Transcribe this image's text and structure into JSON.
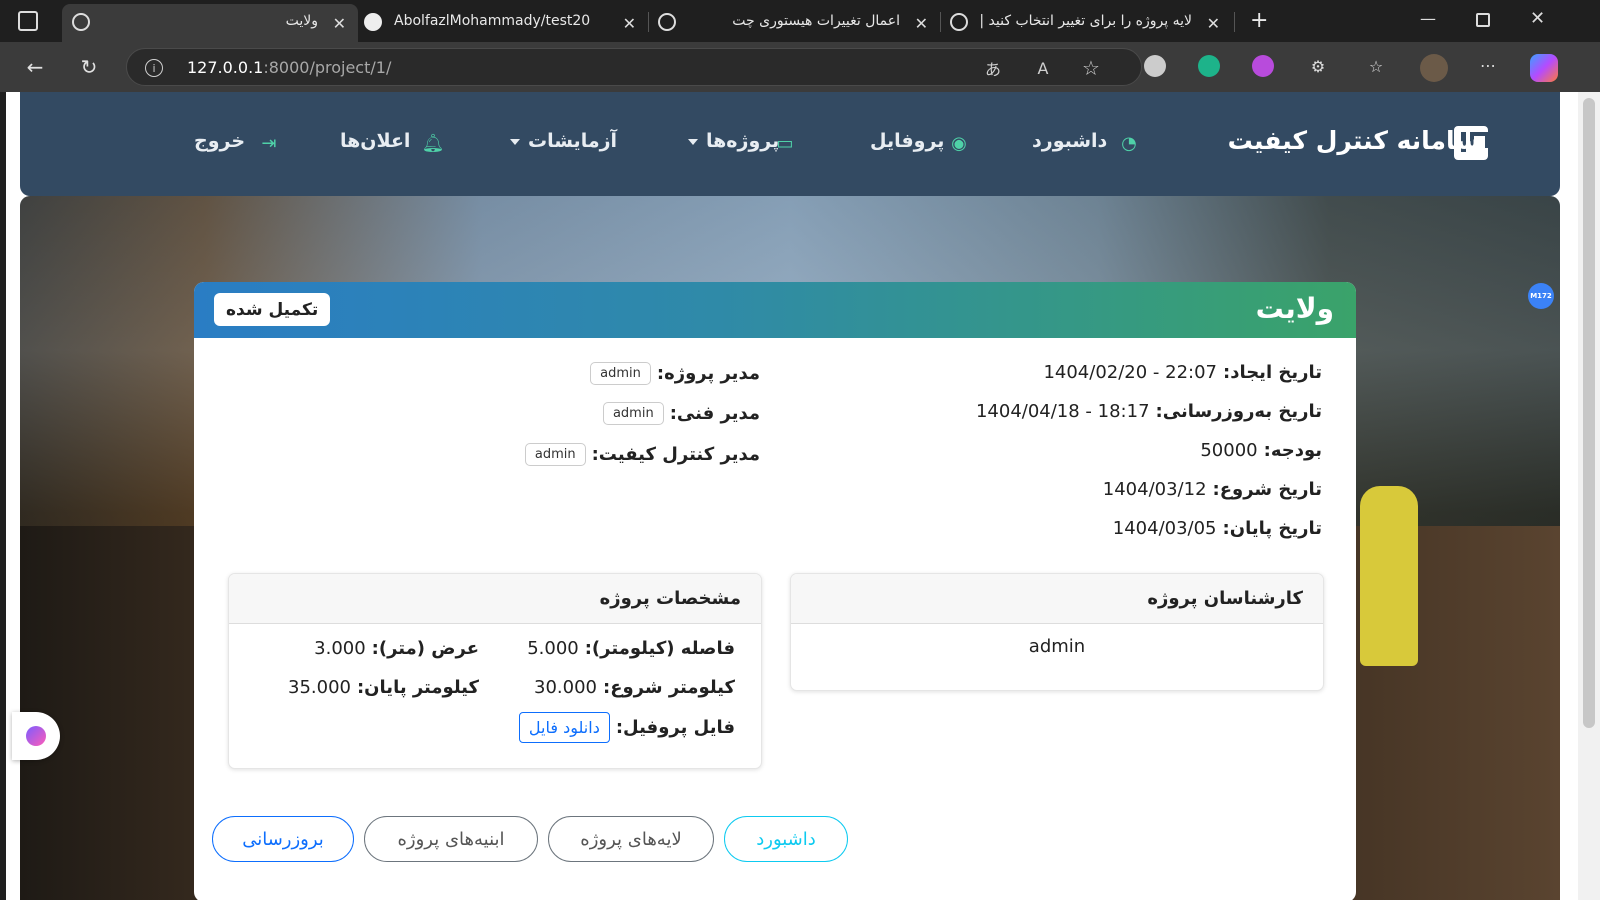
{
  "browser": {
    "tabs": [
      {
        "title": "ولایت",
        "icon": "globe-icon"
      },
      {
        "title": "AbolfazlMohammady/test20",
        "icon": "github-icon"
      },
      {
        "title": "اعمال تغییرات هیستوری چت",
        "icon": "chatgpt-icon"
      },
      {
        "title": "لایه پروژه را برای تغییر انتخاب کنید |",
        "icon": "globe-icon"
      }
    ],
    "url_host": "127.0.0.1",
    "url_rest": ":8000/project/1/"
  },
  "navbar": {
    "brand": "سامانه کنترل کیفیت",
    "items": [
      {
        "label": "داشبورد",
        "icon": "gauge-icon"
      },
      {
        "label": "پروفایل",
        "icon": "user-circle-icon"
      },
      {
        "label": "پروژه‌ها",
        "icon": "briefcase-icon"
      },
      {
        "label": "آزمایشات",
        "icon": ""
      },
      {
        "label": "اعلان‌ها",
        "icon": "bell-icon"
      },
      {
        "label": "خروج",
        "icon": "logout-icon"
      }
    ]
  },
  "project": {
    "title": "ولایت",
    "status": "تکمیل شده",
    "created_label": "تاریخ ایجاد:",
    "created_value": "1404/02/20 - 22:07",
    "updated_label": "تاریخ به‌روزرسانی:",
    "updated_value": "1404/04/18 - 18:17",
    "budget_label": "بودجه:",
    "budget_value": "50000",
    "start_label": "تاریخ شروع:",
    "start_value": "1404/03/12",
    "end_label": "تاریخ پایان:",
    "end_value": "1404/03/05",
    "pm_label": "مدیر پروژه:",
    "pm_value": "admin",
    "tech_label": "مدیر فنی:",
    "tech_value": "admin",
    "qc_label": "مدیر کنترل کیفیت:",
    "qc_value": "admin"
  },
  "experts": {
    "title": "کارشناسان پروژه",
    "items": [
      "admin"
    ]
  },
  "specs": {
    "title": "مشخصات پروژه",
    "distance_label": "فاصله (کیلومتر):",
    "distance_value": "5.000",
    "width_label": "عرض (متر):",
    "width_value": "3.000",
    "start_km_label": "کیلومتر شروع:",
    "start_km_value": "30.000",
    "end_km_label": "کیلومتر پایان:",
    "end_km_value": "35.000",
    "profile_label": "فایل پروفیل:",
    "download_label": "دانلود فایل"
  },
  "actions": {
    "dashboard": "داشبورد",
    "layers": "لایه‌های پروژه",
    "structures": "ابنیه‌های پروژه",
    "update": "بروزرسانی"
  },
  "overlay": {
    "badge": "M172"
  },
  "colors": {
    "navbar": "#334a62",
    "accent": "#4fd1a8",
    "primary": "#0d6efd",
    "info": "#0dcaf0"
  }
}
